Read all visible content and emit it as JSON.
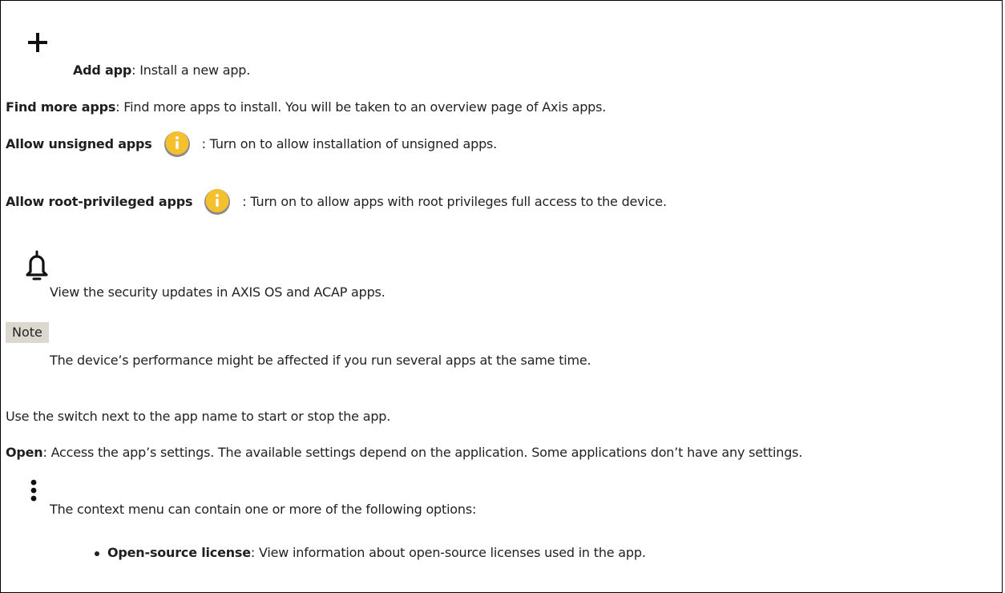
{
  "add_app": {
    "icon": "plus-icon",
    "label": "Add app",
    "desc": ": Install a new app."
  },
  "find_more": {
    "label": "Find more apps",
    "desc": ": Find more apps to install. You will be taken to an overview page of Axis apps."
  },
  "unsigned": {
    "label": "Allow unsigned apps",
    "icon": "info-icon",
    "desc": ": Turn on to allow installation of unsigned apps."
  },
  "root_priv": {
    "label": "Allow root-privileged apps",
    "icon": "info-icon",
    "desc": ": Turn on to allow apps with root privileges full access to the device."
  },
  "security": {
    "icon": "bell-icon",
    "desc": "View the security updates in AXIS OS and ACAP apps."
  },
  "note": {
    "label": "Note",
    "text": "The device’s performance might be affected if you run several apps at the same time."
  },
  "switch_text": "Use the switch next to the app name to start or stop the app.",
  "open": {
    "label": "Open",
    "desc": ": Access the app’s settings. The available settings depend on the application. Some applications don’t have any settings."
  },
  "context_menu": {
    "icon": "more-vertical-icon",
    "desc": "The context menu can contain one or more of the following options:",
    "options": [
      {
        "label": "Open-source license",
        "desc": ": View information about open-source licenses used in the app."
      }
    ]
  },
  "colors": {
    "info_fill": "#f5c02e",
    "info_ring": "#8a8a8a",
    "note_bg": "#ddd8cf",
    "text": "#222222"
  }
}
